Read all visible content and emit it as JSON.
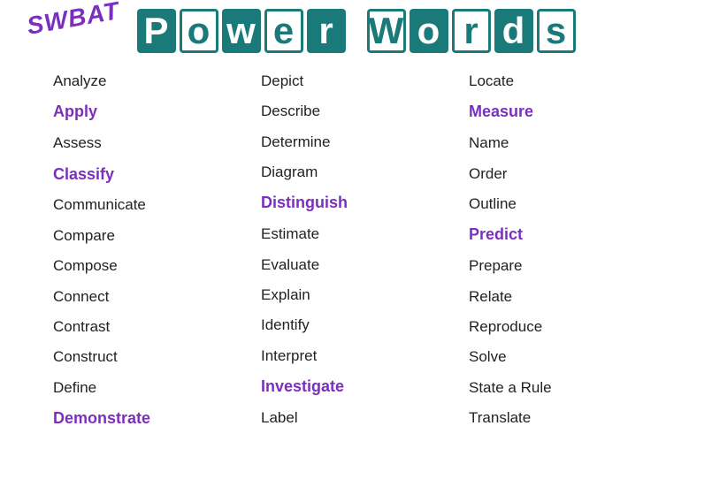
{
  "header": {
    "swbat": "SWBAT",
    "title_letters": [
      {
        "char": "P",
        "style": "filled"
      },
      {
        "char": "o",
        "style": "plain"
      },
      {
        "char": "w",
        "style": "filled"
      },
      {
        "char": "e",
        "style": "plain"
      },
      {
        "char": "r",
        "style": "filled"
      },
      {
        "char": "W",
        "style": "plain"
      },
      {
        "char": "o",
        "style": "filled"
      },
      {
        "char": "r",
        "style": "plain"
      },
      {
        "char": "d",
        "style": "filled"
      },
      {
        "char": "s",
        "style": "plain"
      }
    ]
  },
  "columns": {
    "col1": [
      {
        "text": "Analyze",
        "highlight": false
      },
      {
        "text": "Apply",
        "highlight": true,
        "class": "highlight-apply"
      },
      {
        "text": "Assess",
        "highlight": false
      },
      {
        "text": "Classify",
        "highlight": true,
        "class": "highlight-classify"
      },
      {
        "text": "Communicate",
        "highlight": false
      },
      {
        "text": "Compare",
        "highlight": false
      },
      {
        "text": "Compose",
        "highlight": false
      },
      {
        "text": "Connect",
        "highlight": false
      },
      {
        "text": "Contrast",
        "highlight": false
      },
      {
        "text": "Construct",
        "highlight": false
      },
      {
        "text": "Define",
        "highlight": false
      },
      {
        "text": "Demonstrate",
        "highlight": true,
        "class": "highlight-demonstrate"
      }
    ],
    "col2": [
      {
        "text": "Depict",
        "highlight": false
      },
      {
        "text": "Describe",
        "highlight": false
      },
      {
        "text": "Determine",
        "highlight": false
      },
      {
        "text": "Diagram",
        "highlight": false
      },
      {
        "text": "Distinguish",
        "highlight": true,
        "class": "highlight-distinguish"
      },
      {
        "text": "Estimate",
        "highlight": false
      },
      {
        "text": "Evaluate",
        "highlight": false
      },
      {
        "text": "Explain",
        "highlight": false
      },
      {
        "text": "Identify",
        "highlight": false
      },
      {
        "text": "Interpret",
        "highlight": false
      },
      {
        "text": "Investigate",
        "highlight": true,
        "class": "highlight-investigate"
      },
      {
        "text": "Label",
        "highlight": false
      }
    ],
    "col3": [
      {
        "text": "Locate",
        "highlight": false
      },
      {
        "text": "Measure",
        "highlight": true,
        "class": "highlight-measure"
      },
      {
        "text": "Name",
        "highlight": false
      },
      {
        "text": "Order",
        "highlight": false
      },
      {
        "text": "Outline",
        "highlight": false
      },
      {
        "text": "Predict",
        "highlight": true,
        "class": "highlight-predict"
      },
      {
        "text": "Prepare",
        "highlight": false
      },
      {
        "text": "Relate",
        "highlight": false
      },
      {
        "text": "Reproduce",
        "highlight": false
      },
      {
        "text": "Solve",
        "highlight": false
      },
      {
        "text": "State a Rule",
        "highlight": false
      },
      {
        "text": "Translate",
        "highlight": false
      }
    ]
  }
}
